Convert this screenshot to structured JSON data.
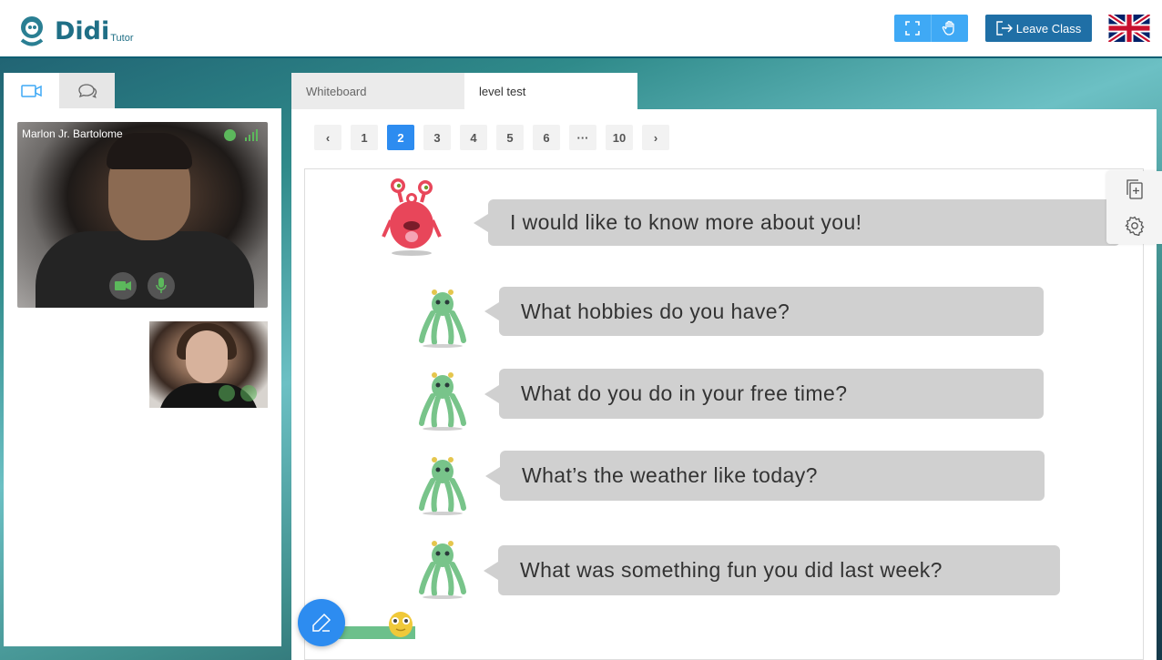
{
  "app": {
    "logo_text": "Didi",
    "logo_sub": "Tutor"
  },
  "header": {
    "leave_label": "Leave Class",
    "tools": [
      "fullscreen-icon",
      "raise-hand-icon"
    ],
    "language_flag": "uk-flag"
  },
  "left_panel": {
    "tabs": [
      "video-icon",
      "chat-icon"
    ],
    "teacher": {
      "name": "Marlon Jr. Bartolome"
    }
  },
  "content_tabs": [
    "Whiteboard",
    "level test"
  ],
  "pagination": {
    "prev": "‹",
    "pages": [
      "1",
      "2",
      "3",
      "4",
      "5",
      "6",
      "···",
      "10"
    ],
    "current": "2",
    "next": "›"
  },
  "slide": {
    "intro": "I would like to know more about  you!",
    "questions": [
      "What hobbies do you  have?",
      "What  do you do  in your  free time?",
      "What’s the weather like  today?",
      "What was something fun you did last week?"
    ]
  },
  "colors": {
    "accent": "#2d8cf0",
    "leave": "#1f6fa6",
    "bubble": "#d0d0d0"
  }
}
